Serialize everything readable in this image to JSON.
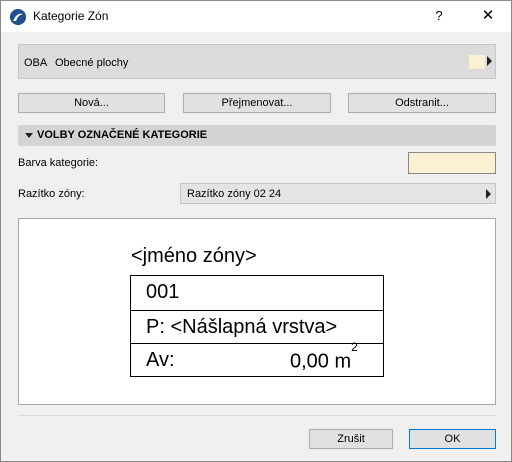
{
  "window": {
    "title": "Kategorie Zón",
    "help_label": "?",
    "close_label": "✕"
  },
  "category": {
    "code": "OBA",
    "name": "Obecné plochy",
    "swatch_color": "#fbf0d2"
  },
  "buttons": {
    "new": "Nová...",
    "rename": "Přejmenovat...",
    "delete": "Odstranit..."
  },
  "section": {
    "title": "VOLBY OZNAČENÉ KATEGORIE"
  },
  "fields": {
    "color_label": "Barva kategorie:",
    "color_value": "#fbf0d2",
    "stamp_label": "Razítko zóny:",
    "stamp_value": "Razítko zóny 02 24"
  },
  "preview": {
    "zone_name": "<jméno zóny>",
    "number": "001",
    "floor_layer": "P: <Nášlapná vrstva>",
    "area_label": "Av:",
    "area_value": "0,00 m",
    "area_exponent": "2"
  },
  "footer": {
    "cancel": "Zrušit",
    "ok": "OK"
  }
}
